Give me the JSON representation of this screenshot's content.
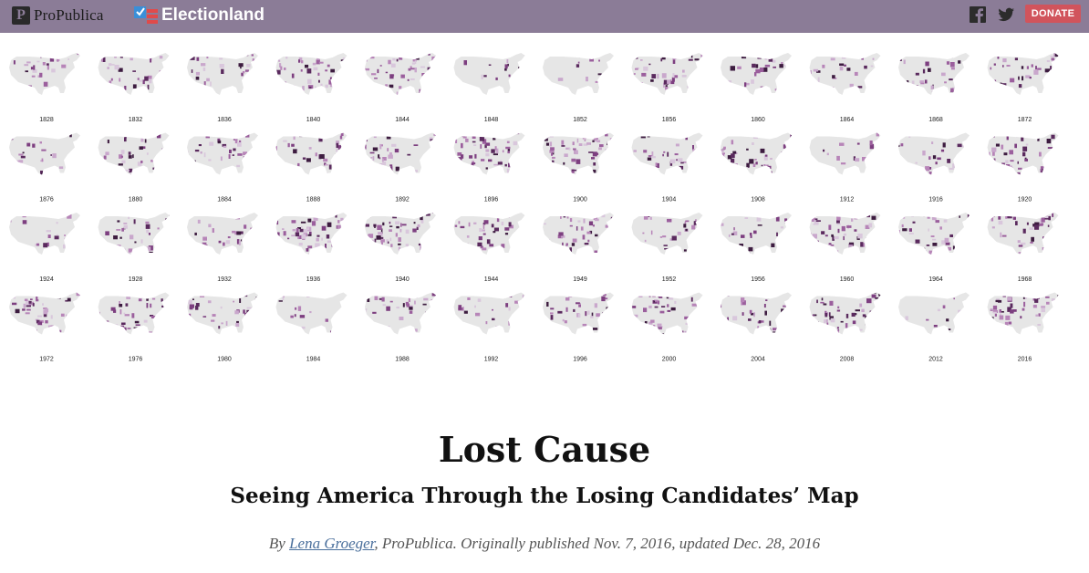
{
  "header": {
    "propublica_label": "ProPublica",
    "propublica_mark": "P",
    "electionland_label": "Electionland",
    "donate_label": "DONATE",
    "bg_color": "#8b7c97"
  },
  "maps": {
    "years": [
      "1828",
      "1832",
      "1836",
      "1840",
      "1844",
      "1848",
      "1852",
      "1856",
      "1860",
      "1864",
      "1868",
      "1872",
      "1876",
      "1880",
      "1884",
      "1888",
      "1892",
      "1896",
      "1900",
      "1904",
      "1908",
      "1912",
      "1916",
      "1920",
      "1924",
      "1928",
      "1932",
      "1936",
      "1940",
      "1944",
      "1949",
      "1952",
      "1956",
      "1960",
      "1964",
      "1968",
      "1972",
      "1976",
      "1980",
      "1984",
      "1988",
      "1992",
      "1996",
      "2000",
      "2004",
      "2008",
      "2012",
      "2016"
    ]
  },
  "article": {
    "title": "Lost Cause",
    "subtitle": "Seeing America Through the Losing Candidates’ Map",
    "byline_prefix": "By ",
    "author": "Lena Groeger",
    "byline_suffix": ", ProPublica. Originally published Nov. 7, 2016, updated Dec. 28, 2016"
  }
}
